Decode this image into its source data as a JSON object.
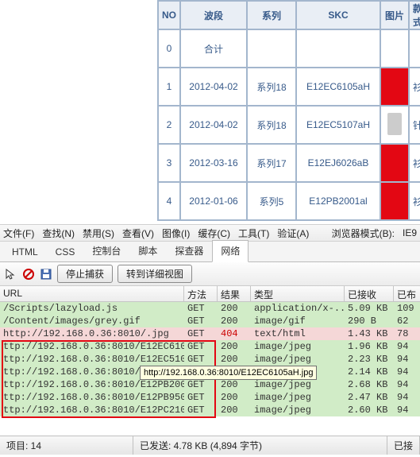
{
  "data_table": {
    "headers": {
      "no": "NO",
      "band": "波段",
      "series": "系列",
      "skc": "SKC",
      "img": "图片",
      "style": "款式"
    },
    "rows": [
      {
        "no": "0",
        "band": "合计",
        "series": "",
        "skc": "",
        "img": "",
        "style": ""
      },
      {
        "no": "1",
        "band": "2012-04-02",
        "series": "系列18",
        "skc": "E12EC6105aH",
        "img": "red",
        "style": "衫"
      },
      {
        "no": "2",
        "band": "2012-04-02",
        "series": "系列18",
        "skc": "E12EC5107aH",
        "img": "thumb",
        "style": "针"
      },
      {
        "no": "3",
        "band": "2012-03-16",
        "series": "系列17",
        "skc": "E12EJ6026aB",
        "img": "red",
        "style": "衫"
      },
      {
        "no": "4",
        "band": "2012-01-06",
        "series": "系列5",
        "skc": "E12PB2001al",
        "img": "red",
        "style": "衫"
      }
    ]
  },
  "menubar": {
    "file": "文件(F)",
    "find": "查找(N)",
    "disable": "禁用(S)",
    "view": "查看(V)",
    "images": "图像(I)",
    "cache": "缓存(C)",
    "tools": "工具(T)",
    "validate": "验证(A)",
    "mode_label": "浏览器模式(B):",
    "mode_value": "IE9"
  },
  "tabs": {
    "html": "HTML",
    "css": "CSS",
    "console": "控制台",
    "script": "脚本",
    "profiler": "探查器",
    "network": "网络"
  },
  "toolbar": {
    "stop": "停止捕获",
    "detail": "转到详细视图"
  },
  "net_headers": {
    "url": "URL",
    "method": "方法",
    "result": "结果",
    "type": "类型",
    "received": "已接收",
    "started": "已布"
  },
  "net_rows": [
    {
      "url": "/Scripts/lazyload.js",
      "method": "GET",
      "result": "200",
      "type": "application/x-...",
      "recv": "5.09 KB",
      "start": "109",
      "cls": "green"
    },
    {
      "url": "/Content/images/grey.gif",
      "method": "GET",
      "result": "200",
      "type": "image/gif",
      "recv": "290 B",
      "start": "62",
      "cls": "green"
    },
    {
      "url": "http://192.168.0.36:8010/.jpg",
      "method": "GET",
      "result": "404",
      "type": "text/html",
      "recv": "1.43 KB",
      "start": "78",
      "cls": "pink"
    },
    {
      "url": "ttp://192.168.0.36:8010/E12EC610...",
      "method": "GET",
      "result": "200",
      "type": "image/jpeg",
      "recv": "1.96 KB",
      "start": "94",
      "cls": "green"
    },
    {
      "url": "ttp://192.168.0.36:8010/E12EC510...",
      "method": "GET",
      "result": "200",
      "type": "image/jpeg",
      "recv": "2.23 KB",
      "start": "94",
      "cls": "green"
    },
    {
      "url": "ttp://192.168.0.36:8010/E12EJ602...",
      "method": "GET",
      "result": "200",
      "type": "image/jpeg",
      "recv": "2.14 KB",
      "start": "94",
      "cls": "green"
    },
    {
      "url": "ttp://192.168.0.36:8010/E12PB200...",
      "method": "GET",
      "result": "200",
      "type": "image/jpeg",
      "recv": "2.68 KB",
      "start": "94",
      "cls": "green"
    },
    {
      "url": "ttp://192.168.0.36:8010/E12PB950...",
      "method": "GET",
      "result": "200",
      "type": "image/jpeg",
      "recv": "2.47 KB",
      "start": "94",
      "cls": "green"
    },
    {
      "url": "ttp://192.168.0.36:8010/E12PC210...",
      "method": "GET",
      "result": "200",
      "type": "image/jpeg",
      "recv": "2.60 KB",
      "start": "94",
      "cls": "green"
    }
  ],
  "tooltip": "http://192.168.0.36:8010/E12EC6105aH.jpg",
  "status": {
    "items": "项目: 14",
    "sent": "已发送: 4.78 KB (4,894 字节)",
    "recv_lbl": "已接"
  }
}
